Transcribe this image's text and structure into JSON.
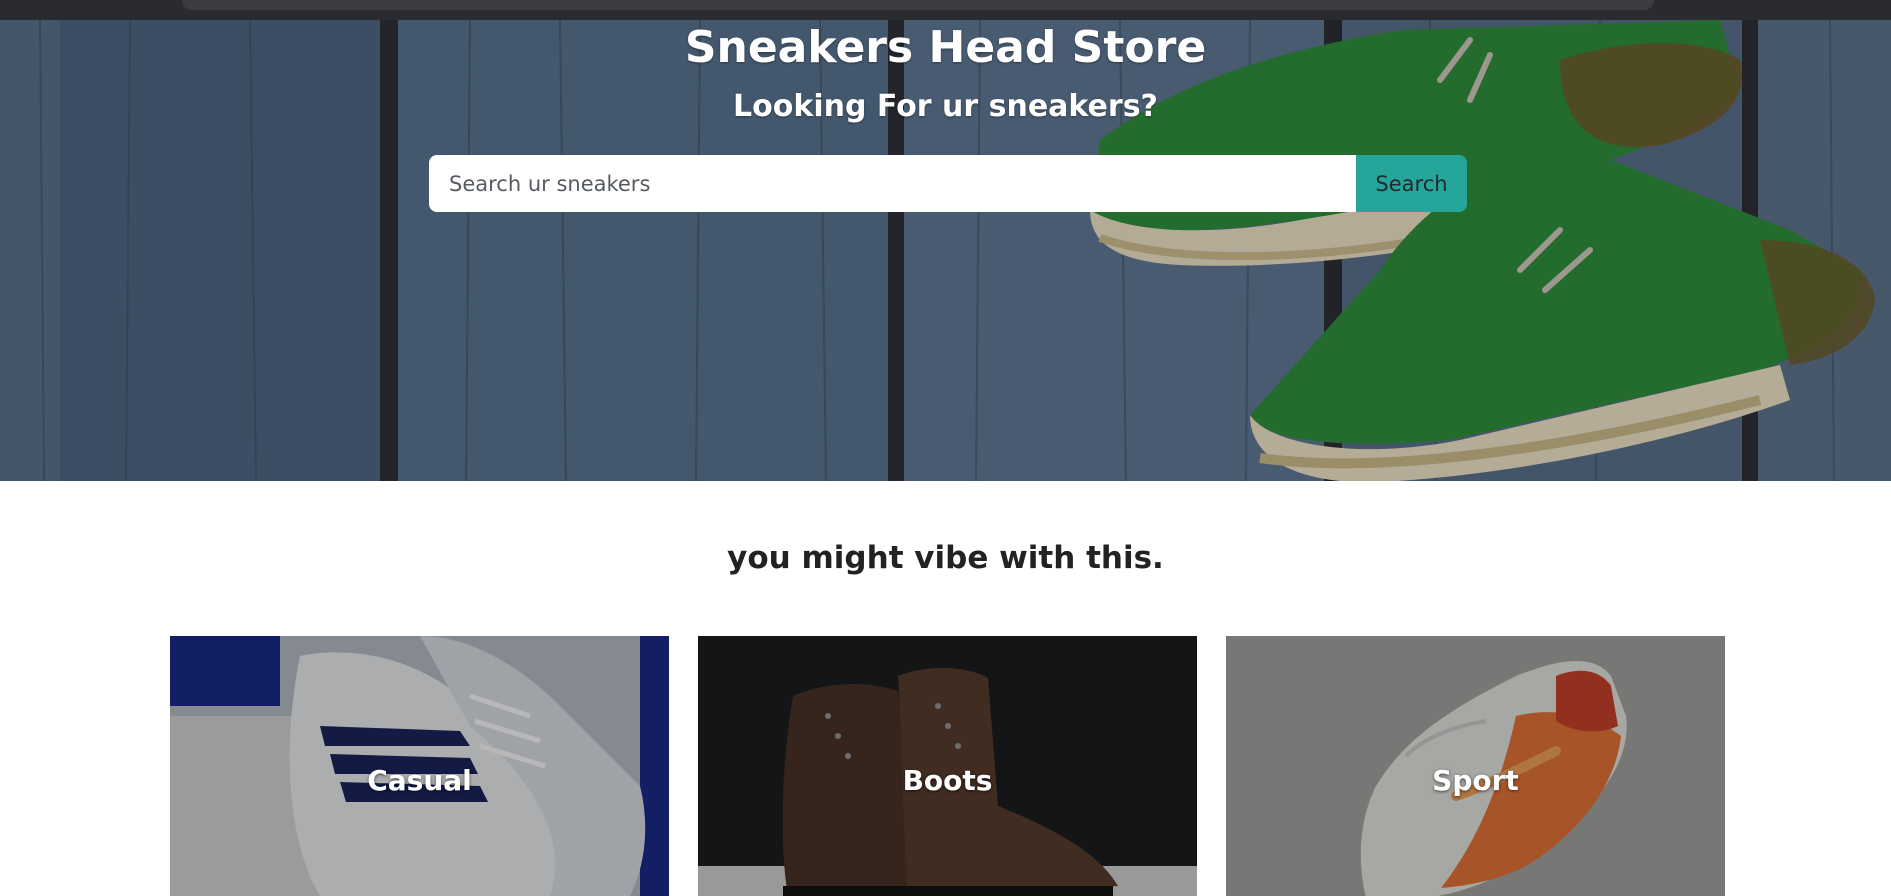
{
  "hero": {
    "title": "Sneakers Head Store",
    "subtitle": "Looking For ur sneakers?",
    "search": {
      "placeholder": "Search ur sneakers",
      "value": "",
      "button_label": "Search"
    }
  },
  "section": {
    "heading": "you might vibe with this."
  },
  "categories": [
    {
      "label": "Casual"
    },
    {
      "label": "Boots"
    },
    {
      "label": "Sport"
    }
  ],
  "colors": {
    "accent": "#26a69a",
    "hero_wood": "#50627a",
    "sneaker_green": "#2e8b3a"
  }
}
